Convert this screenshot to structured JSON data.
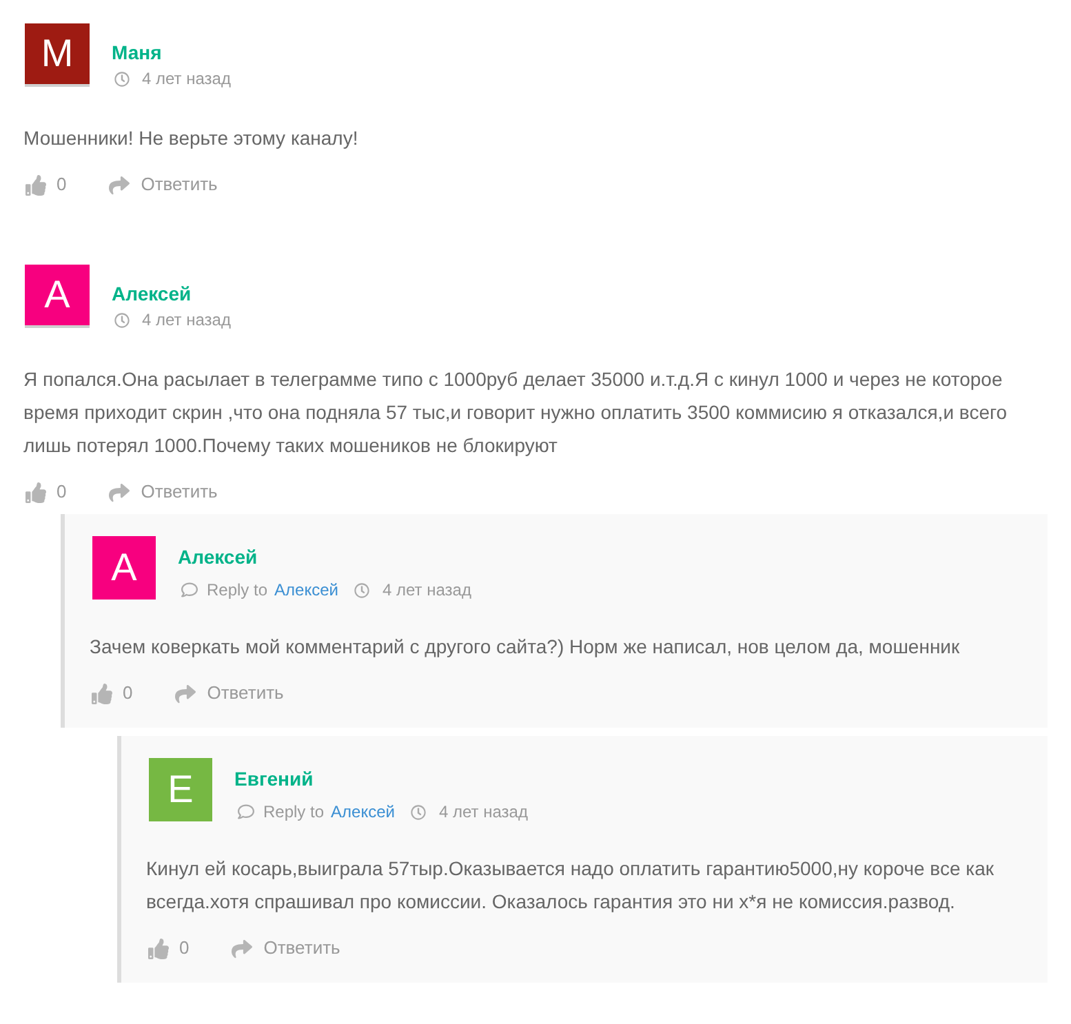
{
  "comments": [
    {
      "author": {
        "name": "Маня",
        "initial": "М",
        "color": "#9e1b12"
      },
      "time": "4 лет назад",
      "text": "Мошенники! Не верьте этому каналу!",
      "votes": "0",
      "reply_label": "Ответить"
    },
    {
      "author": {
        "name": "Алексей",
        "initial": "А",
        "color": "#f7007f"
      },
      "time": "4 лет назад",
      "text": "Я попался.Она расылает в телеграмме типо с 1000руб делает 35000 и.т.д.Я с кинул 1000 и через не которое время приходит скрин ,что она подняла 57 тыс,и говорит нужно оплатить 3500 коммисию я отказался,и всего лишь потерял 1000.Почему таких мошеников не блокируют",
      "votes": "0",
      "reply_label": "Ответить",
      "children": [
        {
          "author": {
            "name": "Алексей",
            "initial": "А",
            "color": "#f7007f"
          },
          "reply_to": {
            "label": "Reply to",
            "name": "Алексей"
          },
          "time": "4 лет назад",
          "text": "Зачем коверкать мой комментарий с другого сайта?) Норм же написал, нов целом да, мошенник",
          "votes": "0",
          "reply_label": "Ответить",
          "children": [
            {
              "author": {
                "name": "Евгений",
                "initial": "Е",
                "color": "#76b843"
              },
              "reply_to": {
                "label": "Reply to",
                "name": "Алексей"
              },
              "time": "4 лет назад",
              "text": "Кинул ей косарь,выиграла 57тыр.Оказывается надо оплатить гарантию5000,ну короче все как всегда.хотя спрашивал про комиссии. Оказалось гарантия это ни х*я не комиссия.развод.",
              "votes": "0",
              "reply_label": "Ответить"
            }
          ]
        }
      ]
    }
  ]
}
